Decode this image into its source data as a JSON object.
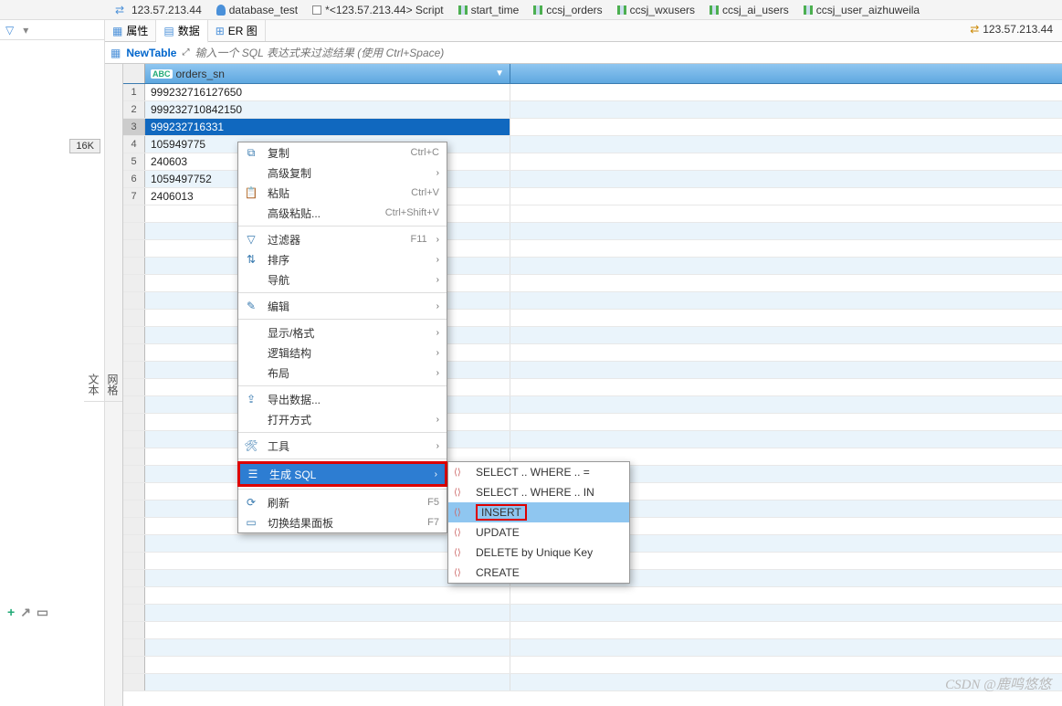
{
  "topTabs": [
    {
      "label": "123.57.213.44",
      "icon": "conn"
    },
    {
      "label": "database_test",
      "icon": "db"
    },
    {
      "label": "*<123.57.213.44> Script",
      "icon": "script"
    },
    {
      "label": "start_time",
      "icon": "col"
    },
    {
      "label": "ccsj_orders",
      "icon": "col"
    },
    {
      "label": "ccsj_wxusers",
      "icon": "col"
    },
    {
      "label": "ccsj_ai_users",
      "icon": "col"
    },
    {
      "label": "ccsj_user_aizhuweila",
      "icon": "col"
    }
  ],
  "viewTabs": {
    "props": "属性",
    "data": "数据",
    "er": "ER 图"
  },
  "rightIp": "123.57.213.44",
  "filterBar": {
    "newtable": "NewTable",
    "placeholder": "输入一个 SQL 表达式来过滤结果 (使用 Ctrl+Space)"
  },
  "column": "orders_sn",
  "abcLabel": "ABC",
  "rows": [
    {
      "n": "1",
      "v": "999232716127650"
    },
    {
      "n": "2",
      "v": "999232710842150"
    },
    {
      "n": "3",
      "v": "999232716331",
      "sel": true
    },
    {
      "n": "4",
      "v": "105949775"
    },
    {
      "n": "5",
      "v": "240603"
    },
    {
      "n": "6",
      "v": "1059497752"
    },
    {
      "n": "7",
      "v": "2406013"
    }
  ],
  "leftPill": "16K",
  "ctx": {
    "copy": "复制",
    "copySc": "Ctrl+C",
    "advcopy": "高级复制",
    "paste": "粘贴",
    "pasteSc": "Ctrl+V",
    "advpaste": "高级粘贴...",
    "advpasteSc": "Ctrl+Shift+V",
    "filter": "过滤器",
    "filterSc": "F11",
    "sort": "排序",
    "nav": "导航",
    "edit": "编辑",
    "display": "显示/格式",
    "logic": "逻辑结构",
    "layout": "布局",
    "export": "导出数据...",
    "openwith": "打开方式",
    "tools": "工具",
    "gensql": "生成 SQL",
    "refresh": "刷新",
    "refreshSc": "F5",
    "togglepanel": "切换结果面板",
    "togglepanelSc": "F7"
  },
  "sub": {
    "sel_eq": "SELECT .. WHERE .. =",
    "sel_in": "SELECT .. WHERE .. IN",
    "insert": "INSERT",
    "update": "UPDATE",
    "delete": "DELETE by Unique Key",
    "create": "CREATE"
  },
  "sideTabs": {
    "a": "网格",
    "b": "文本"
  },
  "watermark": "CSDN @鹿鸣悠悠"
}
